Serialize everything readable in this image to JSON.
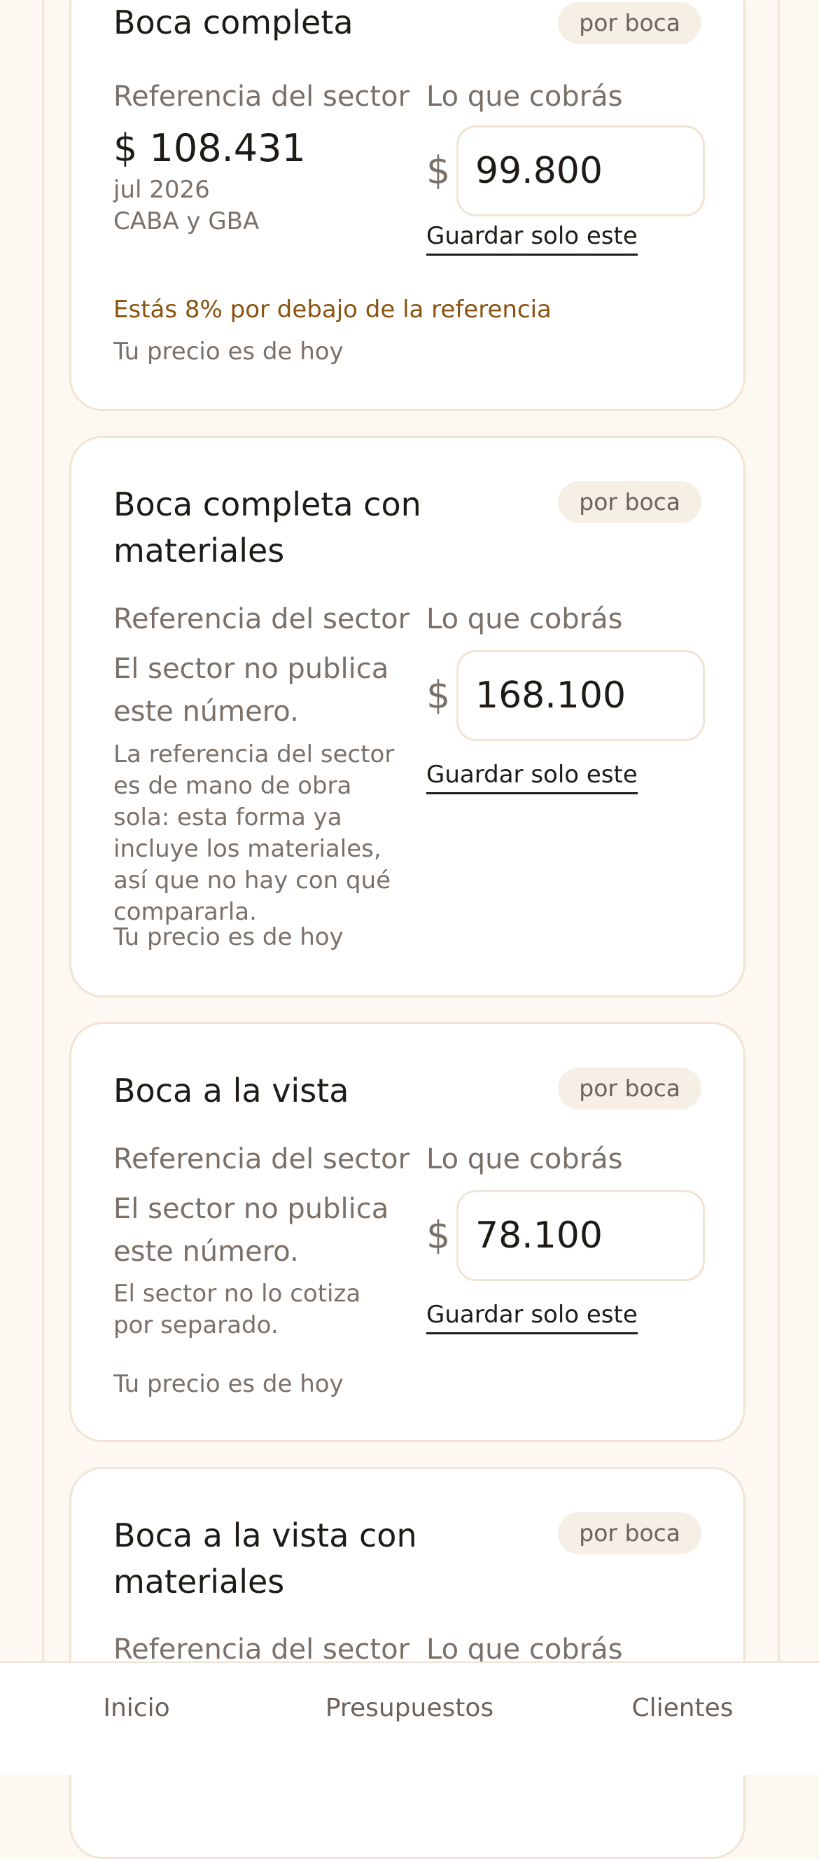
{
  "cards": [
    {
      "title": "Boca completa",
      "unit": "por boca",
      "reference_label": "Referencia del sector",
      "charge_label": "Lo que cobrás",
      "reference_value": "$ 108.431",
      "reference_date": "jul 2026",
      "reference_region": "CABA y GBA",
      "currency": "$",
      "price": "99.800",
      "save_label": "Guardar solo este",
      "diff_note": "Estás 8% por debajo de la referencia",
      "today_note": "Tu precio es de hoy"
    },
    {
      "title": "Boca completa con materiales",
      "unit": "por boca",
      "reference_label": "Referencia del sector",
      "charge_label": "Lo que cobrás",
      "reference_none": "El sector no publica este número.",
      "reference_note": "La referencia del sector es de mano de obra sola: esta forma ya incluye los materiales, así que no hay con qué compararla.",
      "currency": "$",
      "price": "168.100",
      "save_label": "Guardar solo este",
      "today_note": "Tu precio es de hoy"
    },
    {
      "title": "Boca a la vista",
      "unit": "por boca",
      "reference_label": "Referencia del sector",
      "charge_label": "Lo que cobrás",
      "reference_none": "El sector no publica este número.",
      "reference_note": "El sector no lo cotiza por separado.",
      "currency": "$",
      "price": "78.100",
      "save_label": "Guardar solo este",
      "today_note": "Tu precio es de hoy"
    },
    {
      "title": "Boca a la vista con materiales",
      "unit": "por boca",
      "reference_label": "Referencia del sector",
      "charge_label": "Lo que cobrás"
    }
  ],
  "nav": {
    "items": [
      "Inicio",
      "Presupuestos",
      "Clientes"
    ]
  }
}
